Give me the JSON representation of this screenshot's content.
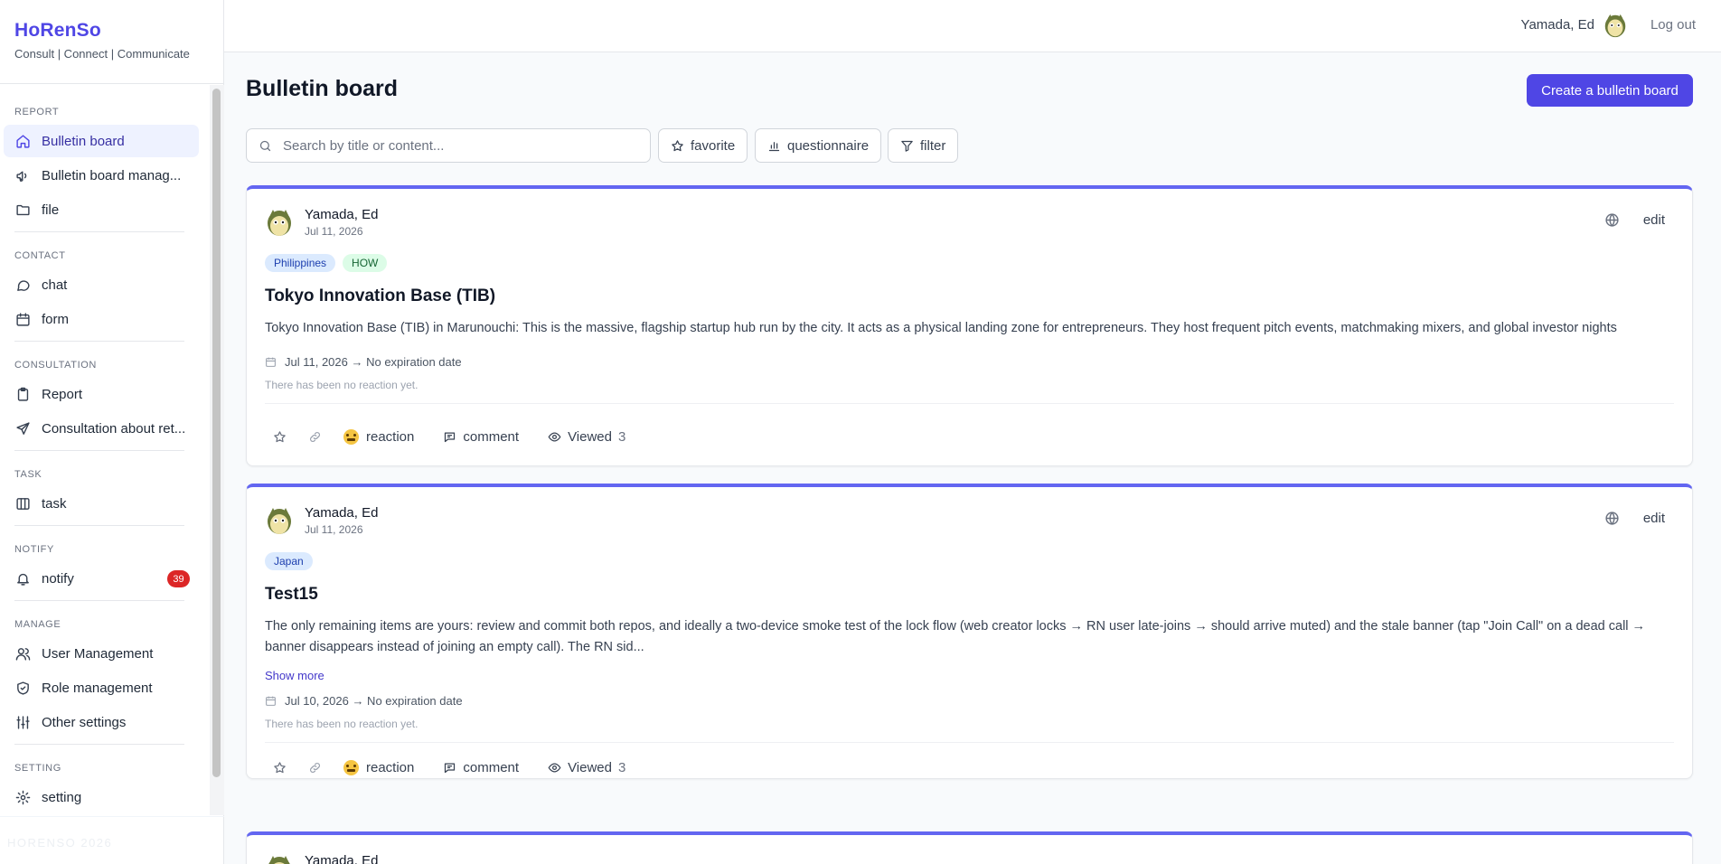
{
  "brand": {
    "title": "HoRenSo",
    "subtitle": "Consult | Connect | Communicate"
  },
  "sidebar": {
    "sections": [
      {
        "label": "REPORT",
        "items": [
          {
            "label": "Bulletin board",
            "icon": "home-icon",
            "active": true
          },
          {
            "label": "Bulletin board manag...",
            "icon": "megaphone-icon"
          },
          {
            "label": "file",
            "icon": "folder-icon"
          }
        ]
      },
      {
        "label": "CONTACT",
        "items": [
          {
            "label": "chat",
            "icon": "chat-icon"
          },
          {
            "label": "form",
            "icon": "calendar-icon"
          }
        ]
      },
      {
        "label": "CONSULTATION",
        "items": [
          {
            "label": "Report",
            "icon": "clipboard-icon"
          },
          {
            "label": "Consultation about ret...",
            "icon": "plane-icon"
          }
        ]
      },
      {
        "label": "TASK",
        "items": [
          {
            "label": "task",
            "icon": "columns-icon"
          }
        ]
      },
      {
        "label": "NOTIFY",
        "items": [
          {
            "label": "notify",
            "icon": "bell-icon",
            "badge": "39"
          }
        ]
      },
      {
        "label": "MANAGE",
        "items": [
          {
            "label": "User Management",
            "icon": "users-icon"
          },
          {
            "label": "Role management",
            "icon": "shield-icon"
          },
          {
            "label": "Other settings",
            "icon": "sliders-icon"
          }
        ]
      },
      {
        "label": "SETTING",
        "items": [
          {
            "label": "setting",
            "icon": "gear-icon"
          }
        ]
      }
    ],
    "footer": "HORENSO 2026"
  },
  "header": {
    "user_name": "Yamada, Ed",
    "logout": "Log out"
  },
  "main": {
    "title": "Bulletin board",
    "create_button": "Create a bulletin board",
    "search_placeholder": "Search by title or content...",
    "filters": {
      "favorite": "favorite",
      "questionnaire": "questionnaire",
      "filter": "filter"
    },
    "posts": [
      {
        "author": "Yamada, Ed",
        "date": "Jul 11, 2026",
        "edit": "edit",
        "tags": [
          {
            "label": "Philippines",
            "color": "blue"
          },
          {
            "label": "HOW",
            "color": "green"
          }
        ],
        "title": "Tokyo Innovation Base (TIB)",
        "body": "Tokyo Innovation Base (TIB) in Marunouchi: This is the massive, flagship startup hub run by the city. It acts as a physical landing zone for entrepreneurs. They host frequent pitch events, matchmaking mixers, and global investor nights",
        "show_more": "",
        "period": "Jul 11, 2026 → No expiration date",
        "no_reaction": "There has been no reaction yet.",
        "reaction": "reaction",
        "comment": "comment",
        "viewed": "Viewed",
        "viewed_count": "3"
      },
      {
        "author": "Yamada, Ed",
        "date": "Jul 11, 2026",
        "edit": "edit",
        "tags": [
          {
            "label": "Japan",
            "color": "blue"
          }
        ],
        "title": "Test15",
        "body": "The only remaining items are yours: review and commit both repos, and ideally a two-device smoke test of the lock flow (web creator locks → RN user late-joins → should arrive muted) and the stale banner (tap \"Join Call\" on a dead call → banner disappears instead of joining an empty call). The RN sid...",
        "show_more": "Show more",
        "period": "Jul 10, 2026 → No expiration date",
        "no_reaction": "There has been no reaction yet.",
        "reaction": "reaction",
        "comment": "comment",
        "viewed": "Viewed",
        "viewed_count": "3"
      },
      {
        "author": "Yamada, Ed"
      }
    ]
  },
  "colors": {
    "accent": "#4f46e5",
    "post_border": "#6366f1",
    "badge": "#dc2626"
  }
}
